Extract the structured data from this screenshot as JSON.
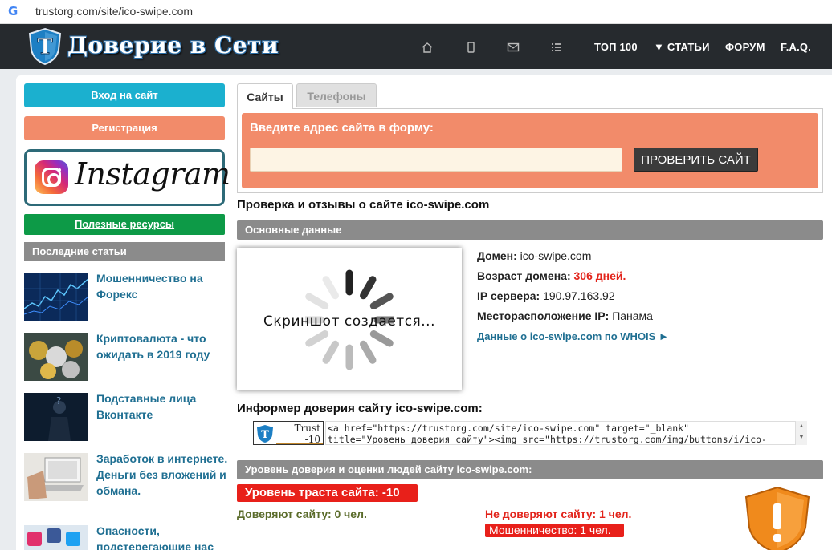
{
  "browser": {
    "url": "trustorg.com/site/ico-swipe.com"
  },
  "header": {
    "logo_letter": "Т",
    "logo_text": "Доверие в Сети",
    "nav": [
      "ТОП 100",
      "▼ СТАТЬИ",
      "ФОРУМ",
      "F.A.Q."
    ]
  },
  "sidebar": {
    "login": "Вход на сайт",
    "register": "Регистрация",
    "instagram": "Instagram",
    "resources": "Полезные ресурсы",
    "recent_heading": "Последние статьи",
    "articles": [
      {
        "title": "Мошенничество на Форекс"
      },
      {
        "title": "Криптовалюта - что ожидать в 2019 году"
      },
      {
        "title": "Подставные лица Вконтакте"
      },
      {
        "title": "Заработок в интернете. Деньги без вложений и обмана."
      },
      {
        "title": "Опасности, подстерегающие нас"
      }
    ]
  },
  "tabs": {
    "sites": "Сайты",
    "phones": "Телефоны"
  },
  "form": {
    "label": "Введите адрес сайта в форму:",
    "value": "",
    "button": "ПРОВЕРИТЬ САЙТ"
  },
  "page_title": "Проверка и отзывы о сайте ico-swipe.com",
  "basic": {
    "heading": "Основные данные",
    "screenshot_text": "Скриншот создается...",
    "domain_label": "Домен:",
    "domain_value": "ico-swipe.com",
    "age_label": "Возраст домена:",
    "age_value": "306 дней.",
    "ip_label": "IP сервера:",
    "ip_value": "190.97.163.92",
    "location_label": "Месторасположение IP:",
    "location_value": "Панама",
    "whois": "Данные о ico-swipe.com по WHOIS ►"
  },
  "informer": {
    "title": "Информер доверия сайту ico-swipe.com:",
    "badge_line1": "Trust",
    "badge_line2": "-10",
    "code_line1": "<a href=\"https://trustorg.com/site/ico-swipe.com\" target=\"_blank\"",
    "code_line2": "title=\"Уровень доверия сайту\"><img src=\"https://trustorg.com/img/buttons/i/ico-"
  },
  "trust": {
    "heading": "Уровень доверия и оценки людей сайту ico-swipe.com:",
    "level": "Уровень траста сайта: -10",
    "trusted": "Доверяют сайту: 0 чел.",
    "distrusted": "Не доверяют сайту: 1 чел.",
    "fraud": "Мошенничество: 1 чел."
  },
  "colors": {
    "header_bg": "#262a2e",
    "login": "#1bb0cf",
    "register": "#f28b6a",
    "resources": "#0d9a47",
    "alert_red": "#e8201a",
    "link": "#1f6f92"
  }
}
